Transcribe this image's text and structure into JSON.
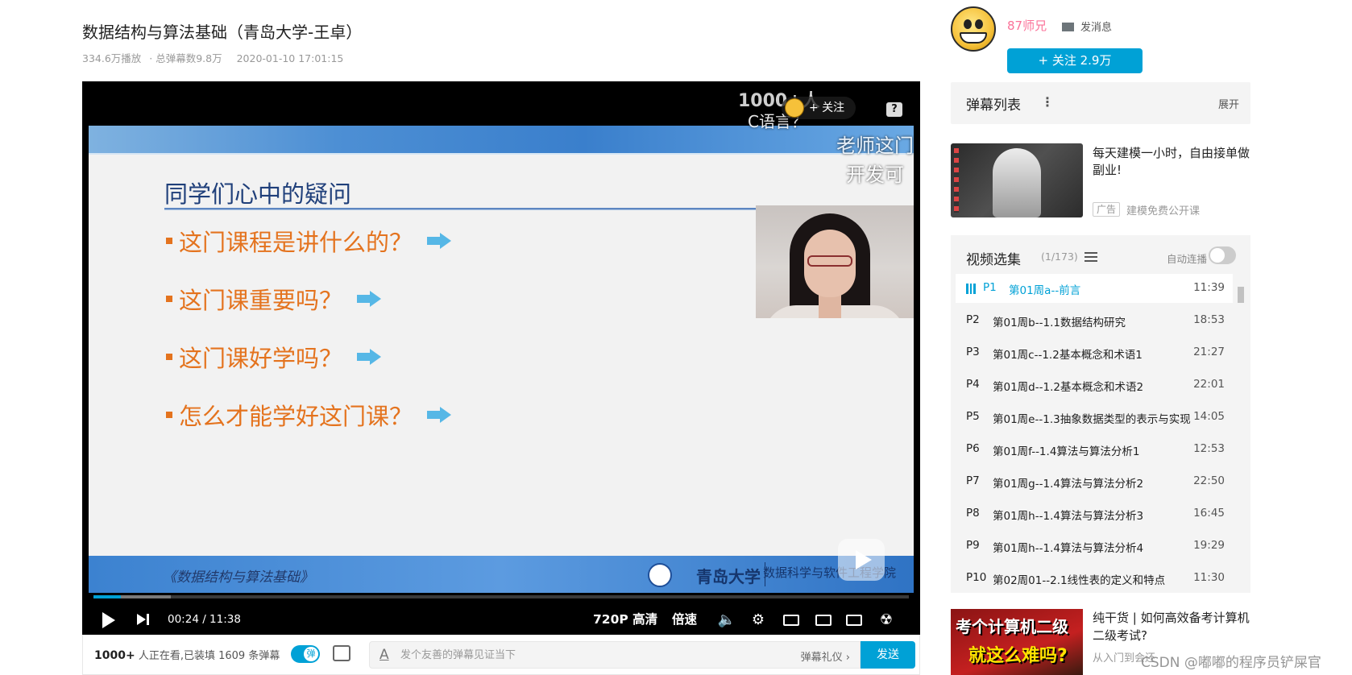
{
  "video": {
    "title": "数据结构与算法基础（青岛大学-王卓）",
    "plays": "334.6万播放",
    "danmaku_total": "· 总弹幕数9.8万",
    "date": "2020-01-10 17:01:15"
  },
  "slide": {
    "heading": "同学们心中的疑问",
    "bullets": [
      "这门课程是讲什么的？",
      "这门课重要吗？",
      "这门课好学吗？",
      "怎么才能学好这门课？"
    ],
    "footer_course": "《数据结构与算法基础》",
    "footer_university": "青岛大学",
    "footer_school": "数据科学与软件工程学院"
  },
  "overlay": {
    "danmaku_1": "1000+人",
    "danmaku_2": "C语言？",
    "danmaku_3": "老师这门",
    "danmaku_4": "开发可",
    "follow": "+ 关注",
    "help": "?"
  },
  "controls": {
    "time_current": "00:24",
    "time_total": "11:38",
    "quality": "720P 高清",
    "speed": "倍速",
    "progress_fraction": 0.034,
    "buffered_fraction": 0.095
  },
  "danmaku_bar": {
    "watching_count": "1000+",
    "watching_text": " 人正在看,已装填 1609 条弹幕",
    "toggle_label": "弹",
    "input_icon": "A",
    "input_placeholder": "发个友善的弹幕见证当下",
    "etiquette": "弹幕礼仪 ›",
    "send": "发送"
  },
  "uploader": {
    "name": "87师兄",
    "message": "发消息",
    "follow": "+  关注 2.9万"
  },
  "danmaku_list": {
    "title": "弹幕列表",
    "menu": "⋮",
    "expand": "展开"
  },
  "ad": {
    "title": "每天建模一小时，自由接单做副业!",
    "tag": "广告",
    "source": "建模免费公开课"
  },
  "playlist": {
    "title": "视频选集",
    "count": "(1/173)",
    "autoplay": "自动连播",
    "episodes": [
      {
        "p": "P1",
        "name": "第01周a--前言",
        "dur": "11:39"
      },
      {
        "p": "P2",
        "name": "第01周b--1.1数据结构研究",
        "dur": "18:53"
      },
      {
        "p": "P3",
        "name": "第01周c--1.2基本概念和术语1",
        "dur": "21:27"
      },
      {
        "p": "P4",
        "name": "第01周d--1.2基本概念和术语2",
        "dur": "22:01"
      },
      {
        "p": "P5",
        "name": "第01周e--1.3抽象数据类型的表示与实现",
        "dur": "14:05"
      },
      {
        "p": "P6",
        "name": "第01周f--1.4算法与算法分析1",
        "dur": "12:53"
      },
      {
        "p": "P7",
        "name": "第01周g--1.4算法与算法分析2",
        "dur": "22:50"
      },
      {
        "p": "P8",
        "name": "第01周h--1.4算法与算法分析3",
        "dur": "16:45"
      },
      {
        "p": "P9",
        "name": "第01周h--1.4算法与算法分析4",
        "dur": "19:29"
      },
      {
        "p": "P10",
        "name": "第02周01--2.1线性表的定义和特点",
        "dur": "11:30"
      }
    ]
  },
  "recommend": {
    "thumb_line1": "考个计算机二级",
    "thumb_line2": "就这么难吗?",
    "title": "纯干货 | 如何高效备考计算机二级考试?",
    "sub": "从入门到会还"
  },
  "watermark": "CSDN @嘟嘟的程序员铲屎官",
  "colors": {
    "accent": "#00a1d6",
    "uploader_name": "#fb7299",
    "slide_orange": "#e4731e",
    "slide_heading": "#1f3f7a"
  }
}
